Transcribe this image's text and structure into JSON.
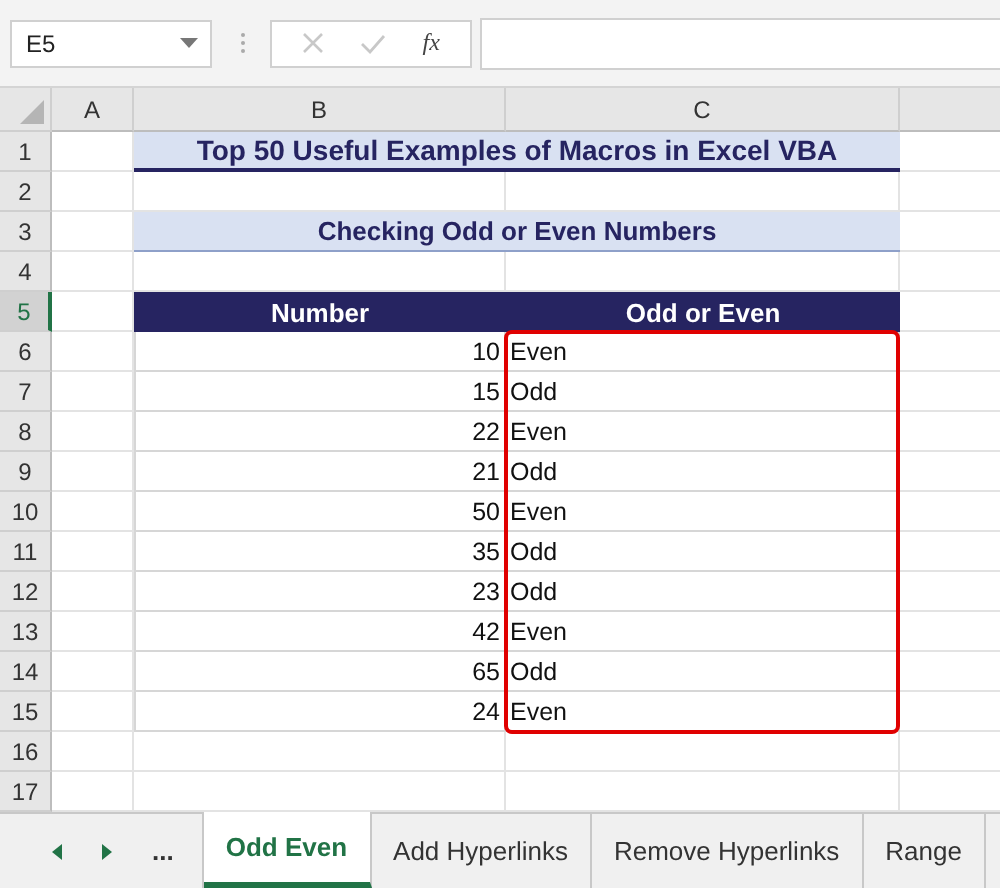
{
  "name_box": {
    "value": "E5"
  },
  "formula_bar": {
    "fx": "fx"
  },
  "column_headers": [
    "A",
    "B",
    "C"
  ],
  "row_headers": [
    {
      "label": "1",
      "selected": false
    },
    {
      "label": "2",
      "selected": false
    },
    {
      "label": "3",
      "selected": false
    },
    {
      "label": "4",
      "selected": false
    },
    {
      "label": "5",
      "selected": true
    },
    {
      "label": "6",
      "selected": false
    },
    {
      "label": "7",
      "selected": false
    },
    {
      "label": "8",
      "selected": false
    },
    {
      "label": "9",
      "selected": false
    },
    {
      "label": "10",
      "selected": false
    },
    {
      "label": "11",
      "selected": false
    },
    {
      "label": "12",
      "selected": false
    },
    {
      "label": "13",
      "selected": false
    },
    {
      "label": "14",
      "selected": false
    },
    {
      "label": "15",
      "selected": false
    },
    {
      "label": "16",
      "selected": false
    },
    {
      "label": "17",
      "selected": false
    }
  ],
  "title": "Top 50 Useful Examples of Macros in Excel VBA",
  "subtitle": "Checking Odd or Even Numbers",
  "table": {
    "columns": [
      "Number",
      "Odd or Even"
    ],
    "rows": [
      [
        "10",
        "Even"
      ],
      [
        "15",
        "Odd"
      ],
      [
        "22",
        "Even"
      ],
      [
        "21",
        "Odd"
      ],
      [
        "50",
        "Even"
      ],
      [
        "35",
        "Odd"
      ],
      [
        "23",
        "Odd"
      ],
      [
        "42",
        "Even"
      ],
      [
        "65",
        "Odd"
      ],
      [
        "24",
        "Even"
      ]
    ]
  },
  "sheet_tabs": {
    "more": "...",
    "tabs": [
      {
        "label": "Odd Even",
        "selected": true
      },
      {
        "label": "Add Hyperlinks",
        "selected": false
      },
      {
        "label": "Remove Hyperlinks",
        "selected": false
      },
      {
        "label": "Range",
        "selected": false
      }
    ]
  }
}
